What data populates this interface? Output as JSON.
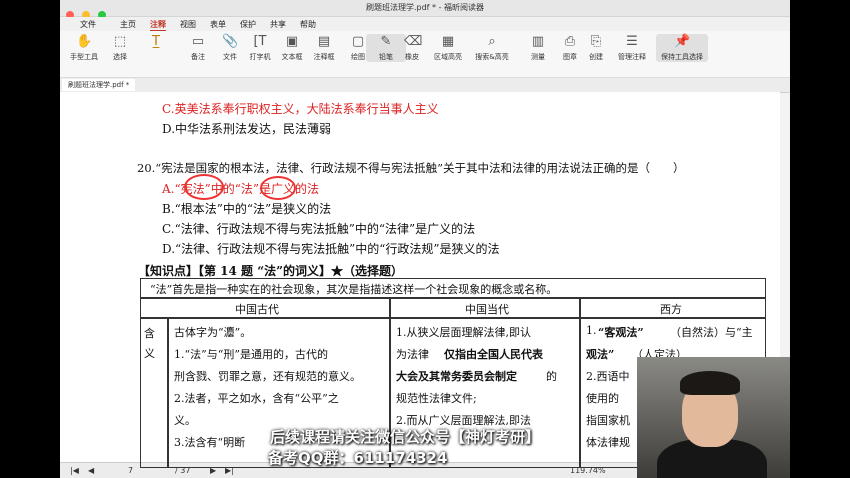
{
  "window": {
    "title": "刷题班法理学.pdf * - 福昕阅读器"
  },
  "menu": [
    "文件",
    "主页",
    "注释",
    "视图",
    "表单",
    "保护",
    "共享",
    "帮助"
  ],
  "menu_active": "注释",
  "ribbon": [
    {
      "icon": "hand-icon",
      "label": "手型工具"
    },
    {
      "icon": "select-icon",
      "label": "选择"
    },
    {
      "icon": "highlight-text-icon",
      "label": ""
    },
    {
      "icon": "note-icon",
      "label": "备注"
    },
    {
      "icon": "file-icon",
      "label": "文件"
    },
    {
      "icon": "typewriter-icon",
      "label": "打字机"
    },
    {
      "icon": "textbox-icon",
      "label": "文本框"
    },
    {
      "icon": "callout-icon",
      "label": "注释框"
    },
    {
      "icon": "draw-icon",
      "label": "绘图"
    },
    {
      "icon": "pencil-icon",
      "label": "铅笔"
    },
    {
      "icon": "eraser-icon",
      "label": "橡皮"
    },
    {
      "icon": "area-highlight-icon",
      "label": "区域高亮"
    },
    {
      "icon": "search-highlight-icon",
      "label": "搜索&高亮"
    },
    {
      "icon": "measure-icon",
      "label": "测量"
    },
    {
      "icon": "stamp-icon",
      "label": "图章"
    },
    {
      "icon": "create-icon",
      "label": "创建"
    },
    {
      "icon": "manage-annot-icon",
      "label": "管理注释"
    },
    {
      "icon": "pin-icon",
      "label": "保持工具选择"
    }
  ],
  "doc_tab": "刷题班法理学.pdf *",
  "page_lines": {
    "c_prev": "C.英美法系奉行职权主义，大陆法系奉行当事人主义",
    "d_prev": "D.中华法系刑法发达，民法薄弱",
    "q20": "20.“宪法是国家的根本法，法律、行政法规不得与宪法抵触”关于其中法和法律的用法说法正确的是（　　）",
    "opt_a": "A.“宪法”中的“法”是广义的法",
    "opt_b": "B.“根本法”中的“法”是狭义的法",
    "opt_c": "C.“法律、行政法规不得与宪法抵触”中的“法律”是广义的法",
    "opt_d": "D.“法律、行政法规不得与宪法抵触”中的“行政法规”是狭义的法",
    "knowledge": "【知识点】【第 14 题 “法”的词义】★（选择题）"
  },
  "table": {
    "intro": "“法”首先是指一种实在的社会现象，其次是指描述这样一个社会现象的概念或名称。",
    "headers": [
      "中国古代",
      "中国当代",
      "西方"
    ],
    "row_label": "含义",
    "col1": [
      "古体字为“灋”。",
      "1.“法”与“刑”是通用的，古代的",
      "刑含戮、罚罪之意，还有规范的意义。",
      "2.法者，平之如水，含有“公平”之",
      "义。",
      "3.法含有“明断"
    ],
    "col2": [
      "1.从狭义层面理解法律,即认",
      "为法律",
      "仅指由全国人民代表",
      "大会及其常务委员会制定",
      "的",
      "规范性法律文件;",
      "2.而从广义层面理解法,即法"
    ],
    "col3": [
      "1.",
      "“客观法”",
      "（自然法）与“主",
      "观法”",
      "（人定法）",
      "2.西语中",
      "使用的",
      "指国家机",
      "体法律规"
    ]
  },
  "status": {
    "page_current": "7",
    "page_total": "/ 37",
    "zoom": "119.74%"
  },
  "subtitle": {
    "line1": "后续课程请关注微信公众号【神灯考研】",
    "line2": "备考QQ群：611174324"
  },
  "colors": {
    "accent": "#c0392b",
    "red_text": "#dd2222"
  }
}
